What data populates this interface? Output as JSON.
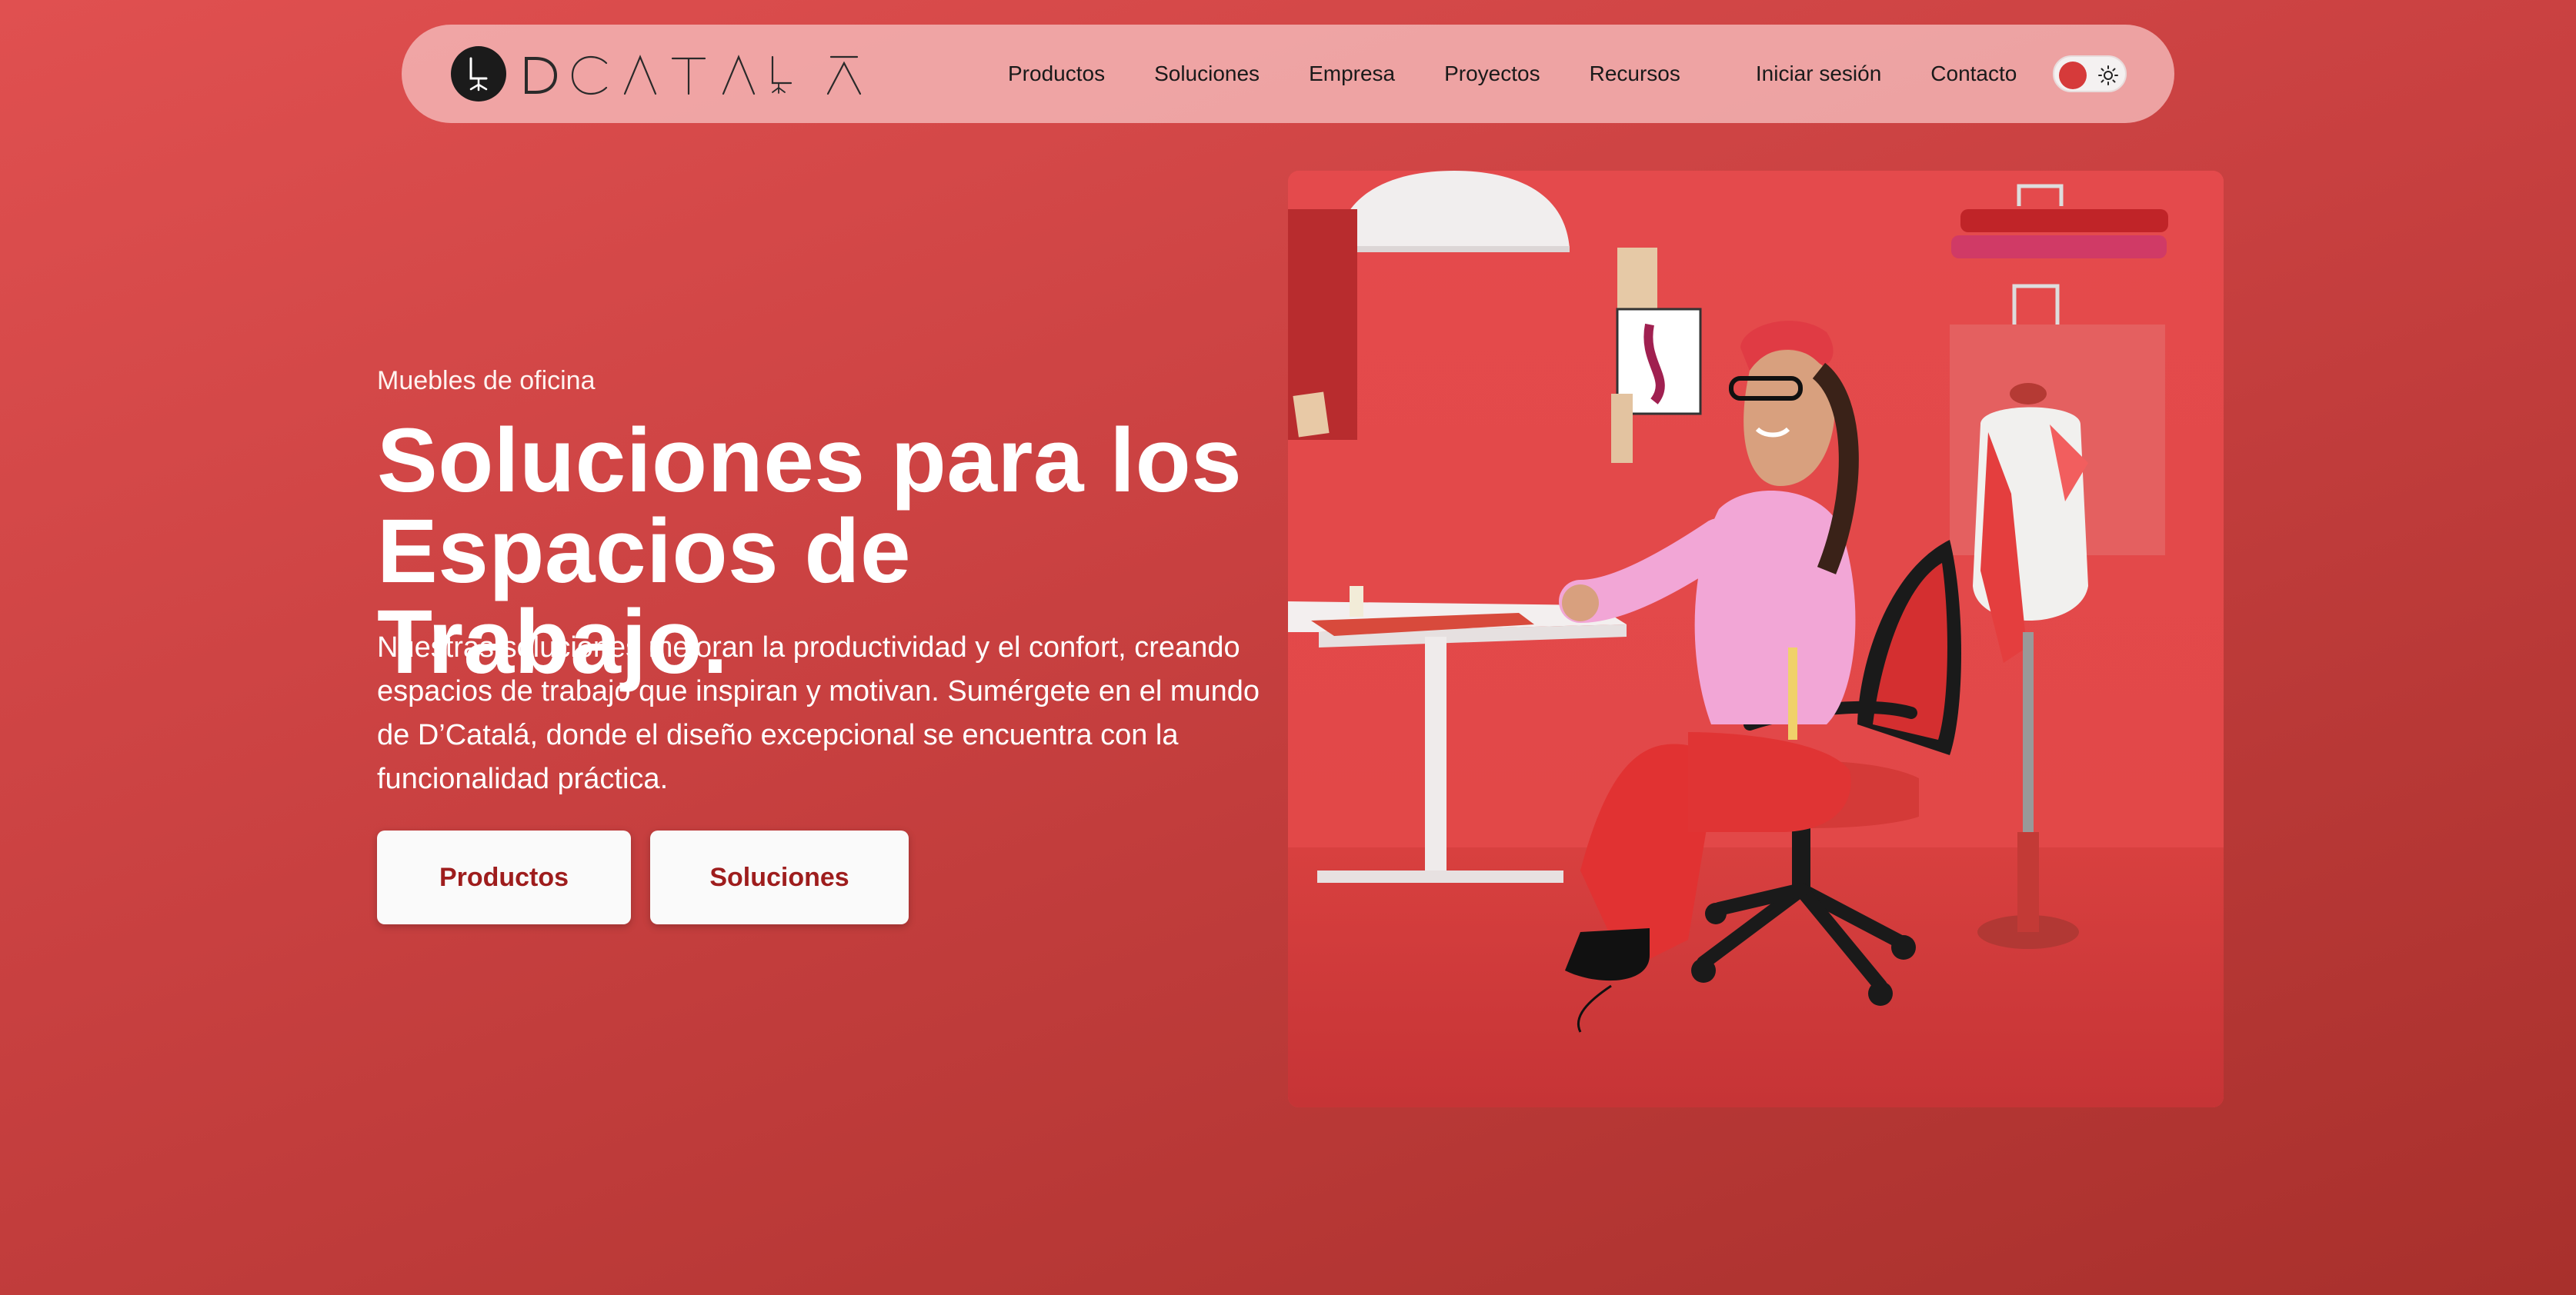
{
  "brand": {
    "name": "DCATALA"
  },
  "nav": {
    "links": [
      {
        "label": "Productos"
      },
      {
        "label": "Soluciones"
      },
      {
        "label": "Empresa"
      },
      {
        "label": "Proyectos"
      },
      {
        "label": "Recursos"
      },
      {
        "label": "Iniciar sesión"
      },
      {
        "label": "Contacto"
      }
    ],
    "theme_toggle": {
      "state": "light",
      "icons": [
        "circle-knob",
        "sun-icon"
      ]
    }
  },
  "hero": {
    "eyebrow": "Muebles de oficina",
    "headline_line1": "Soluciones para los",
    "headline_line2": "Espacios de Trabajo.",
    "lead": "Nuestras soluciones mejoran la productividad y el confort, creando espacios de trabajo que inspiran y motivan. Sumérgete en el mundo de D’Catalá, donde el diseño excepcional se encuentra con la funcionalidad práctica.",
    "buttons": {
      "primary": "Productos",
      "secondary": "Soluciones"
    }
  },
  "colors": {
    "background": "#c84040",
    "accent": "#9e1d1d",
    "nav_bg": "#f4bcbc"
  }
}
